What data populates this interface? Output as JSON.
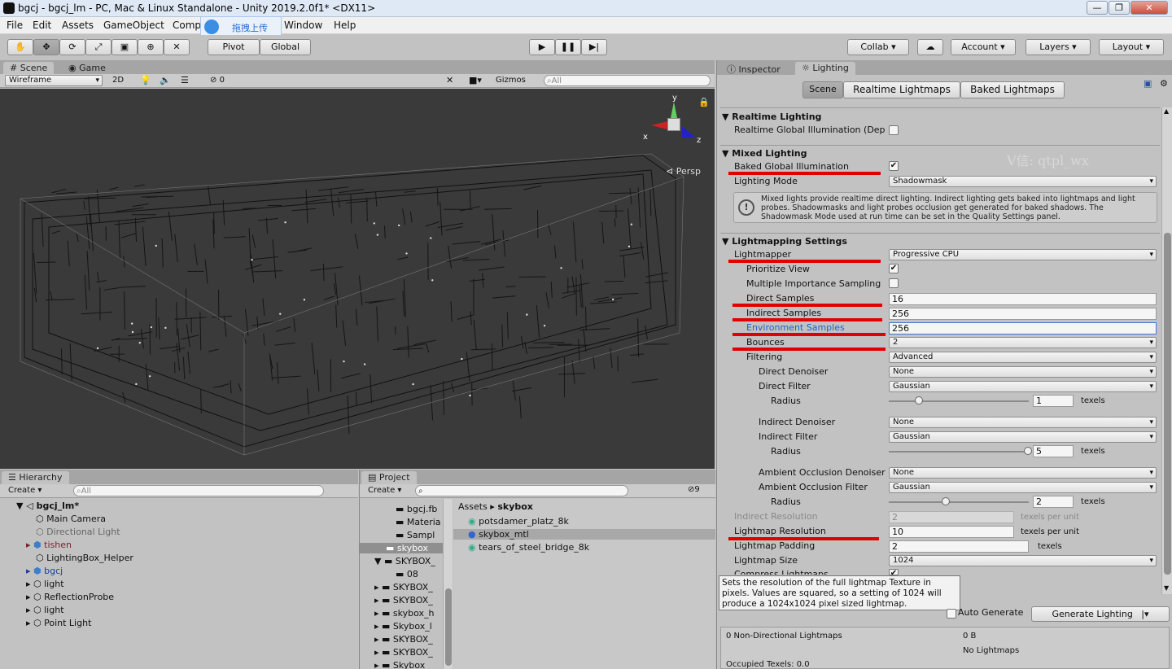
{
  "window": {
    "title": "bgcj - bgcj_lm - PC, Mac & Linux Standalone - Unity 2019.2.0f1* <DX11>",
    "min": "—",
    "max": "❐",
    "close": "✕"
  },
  "menu": [
    "File",
    "Edit",
    "Assets",
    "GameObject",
    "Comp",
    "Window",
    "Help"
  ],
  "upload_overlay": {
    "label": "拖拽上传"
  },
  "toolbar": {
    "pivot": "Pivot",
    "global": "Global",
    "collab": "Collab",
    "account": "Account",
    "layers": "Layers",
    "layout": "Layout"
  },
  "scene": {
    "tab_scene": "Scene",
    "tab_game": "Game",
    "draw_mode": "Wireframe",
    "mode2d": "2D",
    "fx_count": "0",
    "gizmos": "Gizmos",
    "search_placeholder": "All",
    "persp": "Persp",
    "axis_x": "x",
    "axis_y": "y",
    "axis_z": "z",
    "watermark": "V信: qtpl_wx"
  },
  "inspector": {
    "tab_inspector": "Inspector",
    "tab_lighting": "Lighting",
    "seg_scene": "Scene",
    "seg_realtime": "Realtime Lightmaps",
    "seg_baked": "Baked Lightmaps"
  },
  "lighting": {
    "realtime_header": "Realtime Lighting",
    "realtime_gi": "Realtime Global Illumination (Dep",
    "mixed_header": "Mixed Lighting",
    "baked_gi": "Baked Global Illumination",
    "lighting_mode": "Lighting Mode",
    "lighting_mode_value": "Shadowmask",
    "info_text": "Mixed lights provide realtime direct lighting. Indirect lighting gets baked into lightmaps and light probes. Shadowmasks and light probes occlusion get generated for baked shadows. The Shadowmask Mode used at run time can be set in the Quality Settings panel.",
    "lm_header": "Lightmapping Settings",
    "lightmapper": "Lightmapper",
    "lightmapper_value": "Progressive CPU",
    "prioritize_view": "Prioritize View",
    "mis": "Multiple Importance Sampling",
    "direct_samples": "Direct Samples",
    "direct_samples_value": "16",
    "indirect_samples": "Indirect Samples",
    "indirect_samples_value": "256",
    "env_samples": "Environment Samples",
    "env_samples_value": "256",
    "bounces": "Bounces",
    "bounces_value": "2",
    "filtering": "Filtering",
    "filtering_value": "Advanced",
    "direct_denoiser": "Direct Denoiser",
    "direct_denoiser_value": "None",
    "direct_filter": "Direct Filter",
    "direct_filter_value": "Gaussian",
    "radius": "Radius",
    "direct_radius_value": "1",
    "texels": "texels",
    "direct_radius_fraction": 0.2,
    "indirect_denoiser": "Indirect Denoiser",
    "indirect_denoiser_value": "None",
    "indirect_filter": "Indirect Filter",
    "indirect_filter_value": "Gaussian",
    "indirect_radius_value": "5",
    "indirect_radius_fraction": 1.0,
    "ao_denoiser": "Ambient Occlusion Denoiser",
    "ao_denoiser_value": "None",
    "ao_filter": "Ambient Occlusion Filter",
    "ao_filter_value": "Gaussian",
    "ao_radius_value": "2",
    "ao_radius_fraction": 0.4,
    "indirect_resolution": "Indirect Resolution",
    "indirect_resolution_value": "2",
    "texels_per_unit": "texels per unit",
    "lightmap_resolution": "Lightmap Resolution",
    "lightmap_resolution_value": "10",
    "lightmap_padding": "Lightmap Padding",
    "lightmap_padding_value": "2",
    "lightmap_size": "Lightmap Size",
    "lightmap_size_value": "1024",
    "compress": "Compress Lightmaps",
    "tooltip": "Sets the resolution of the full lightmap Texture in pixels. Values are squared, so a setting of 1024 will produce a 1024x1024 pixel sized lightmap.",
    "auto_generate": "Auto Generate",
    "generate": "Generate Lighting",
    "stats_label": "0 Non-Directional Lightmaps",
    "stats_size": "0 B",
    "stats_none": "No Lightmaps",
    "occupied": "Occupied Texels: 0.0"
  },
  "hierarchy": {
    "tab": "Hierarchy",
    "create": "Create",
    "search_placeholder": "All",
    "scene_name": "bgcj_lm*",
    "items": [
      "Main Camera",
      "Directional Light",
      "tishen",
      "LightingBox_Helper",
      "bgcj",
      "light",
      "ReflectionProbe",
      "light",
      "Point Light"
    ]
  },
  "project": {
    "tab": "Project",
    "create": "Create",
    "filter_count": "9",
    "tree": [
      "bgcj.fb",
      "Materia",
      "Sampl",
      "skybox",
      "SKYBOX_",
      "08",
      "SKYBOX_",
      "SKYBOX_",
      "skybox_h",
      "Skybox_l",
      "SKYBOX_",
      "SKYBOX_",
      "Skybox"
    ],
    "breadcrumb_root": "Assets",
    "breadcrumb_leaf": "skybox",
    "files": [
      "potsdamer_platz_8k",
      "skybox_mtl",
      "tears_of_steel_bridge_8k"
    ]
  }
}
